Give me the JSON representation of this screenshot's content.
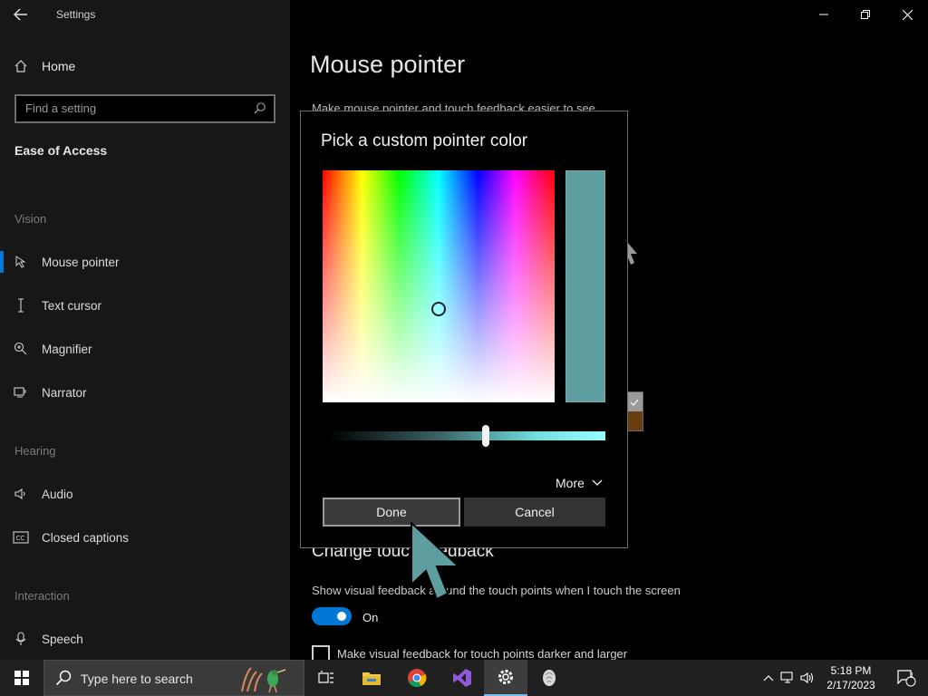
{
  "window": {
    "title": "Settings"
  },
  "sidebar": {
    "home": "Home",
    "search_placeholder": "Find a setting",
    "category": "Ease of Access",
    "sections": {
      "vision": "Vision",
      "hearing": "Hearing",
      "interaction": "Interaction"
    },
    "items": [
      {
        "label": "Mouse pointer",
        "icon": "mouse-pointer-icon",
        "active": true
      },
      {
        "label": "Text cursor",
        "icon": "text-cursor-icon"
      },
      {
        "label": "Magnifier",
        "icon": "magnifier-icon"
      },
      {
        "label": "Narrator",
        "icon": "narrator-icon"
      },
      {
        "label": "Audio",
        "icon": "audio-icon"
      },
      {
        "label": "Closed captions",
        "icon": "closed-captions-icon"
      },
      {
        "label": "Speech",
        "icon": "microphone-icon"
      }
    ]
  },
  "main": {
    "title": "Mouse pointer",
    "subtitle": "Make mouse pointer and touch feedback easier to see.",
    "touch_section_title": "Change touch feedback",
    "touch_desc": "Show visual feedback around the touch points when I touch the screen",
    "toggle_state": "On",
    "checkbox_label": "Make visual feedback for touch points darker and larger"
  },
  "dialog": {
    "title": "Pick a custom pointer color",
    "selected_color": "#5f9ea0",
    "more_label": "More",
    "done_label": "Done",
    "cancel_label": "Cancel"
  },
  "taskbar": {
    "search_placeholder": "Type here to search",
    "time": "5:18 PM",
    "date": "2/17/2023",
    "notification_count": "1"
  },
  "colors": {
    "accent": "#0078d7",
    "pointer_color": "#5f9ea0"
  }
}
